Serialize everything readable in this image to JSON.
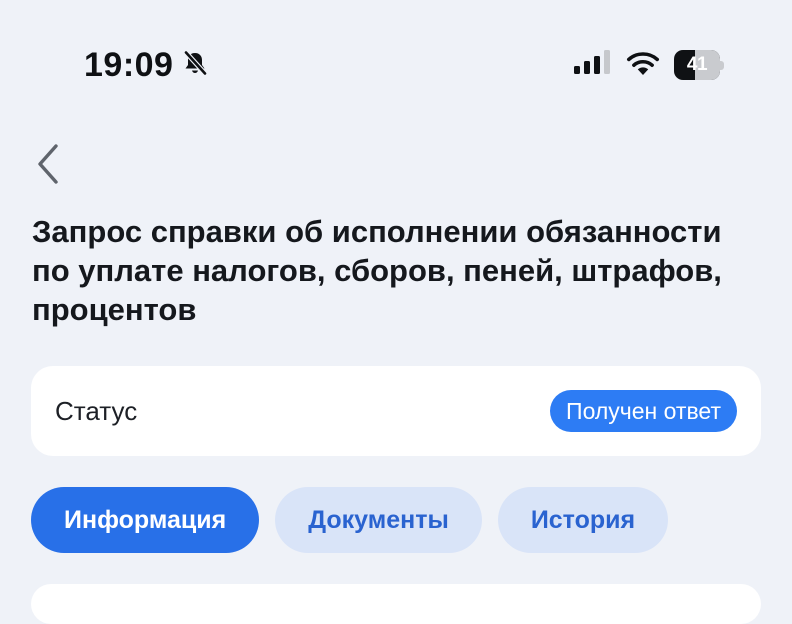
{
  "status_bar": {
    "time": "19:09",
    "battery_level": "41",
    "icons": [
      "bell-slash-icon",
      "cellular-signal-icon",
      "wifi-icon",
      "battery-icon"
    ]
  },
  "header": {
    "back_icon": "chevron-left-icon",
    "title": "Запрос справки об исполнении обязанности по уплате налогов, сборов, пеней, штрафов, процентов"
  },
  "status_card": {
    "label": "Статус",
    "value": "Получен ответ",
    "badge_color": "#2d7cf4"
  },
  "tabs": [
    {
      "label": "Информация",
      "active": true
    },
    {
      "label": "Документы",
      "active": false
    },
    {
      "label": "История",
      "active": false
    }
  ],
  "colors": {
    "background": "#eff2f8",
    "accent": "#2870e8",
    "tab_inactive_bg": "#d9e4f8",
    "tab_inactive_text": "#2a63d0"
  }
}
